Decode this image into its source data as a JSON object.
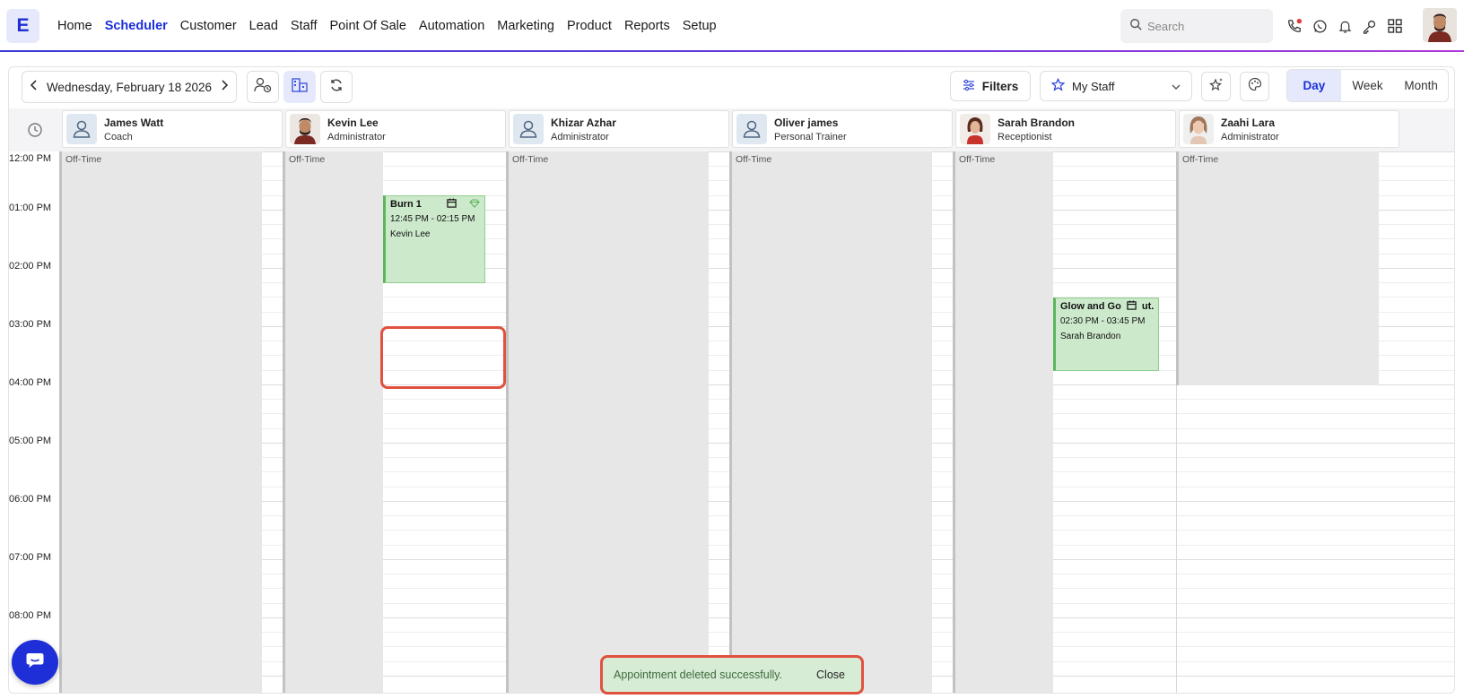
{
  "app": {
    "logo_letter": "E"
  },
  "nav": {
    "items": [
      {
        "label": "Home",
        "active": false
      },
      {
        "label": "Scheduler",
        "active": true
      },
      {
        "label": "Customer",
        "active": false
      },
      {
        "label": "Lead",
        "active": false
      },
      {
        "label": "Staff",
        "active": false
      },
      {
        "label": "Point Of Sale",
        "active": false
      },
      {
        "label": "Automation",
        "active": false
      },
      {
        "label": "Marketing",
        "active": false
      },
      {
        "label": "Product",
        "active": false
      },
      {
        "label": "Reports",
        "active": false
      },
      {
        "label": "Setup",
        "active": false
      }
    ],
    "search_placeholder": "Search",
    "icons": [
      "phone-icon",
      "whatsapp-icon",
      "bell-icon",
      "key-icon",
      "apps-grid-icon"
    ]
  },
  "toolbar": {
    "date": "Wednesday, February 18 2026",
    "filters_label": "Filters",
    "staff_select": "My Staff",
    "views": [
      {
        "label": "Day",
        "active": true
      },
      {
        "label": "Week",
        "active": false
      },
      {
        "label": "Month",
        "active": false
      }
    ]
  },
  "staff": [
    {
      "name": "James Watt",
      "role": "Coach",
      "photo": false
    },
    {
      "name": "Kevin Lee",
      "role": "Administrator",
      "photo": true
    },
    {
      "name": "Khizar Azhar",
      "role": "Administrator",
      "photo": false
    },
    {
      "name": "Oliver james",
      "role": "Personal Trainer",
      "photo": false
    },
    {
      "name": "Sarah Brandon",
      "role": "Receptionist",
      "photo": true
    },
    {
      "name": "Zaahi Lara",
      "role": "Administrator",
      "photo": true
    }
  ],
  "times": [
    "12:00 PM",
    "01:00 PM",
    "02:00 PM",
    "03:00 PM",
    "04:00 PM",
    "05:00 PM",
    "06:00 PM",
    "07:00 PM",
    "08:00 PM"
  ],
  "offtime_label": "Off-Time",
  "appointments": [
    {
      "title": "Burn 1",
      "time": "12:45 PM - 02:15 PM",
      "staff": "Kevin Lee"
    },
    {
      "title": "Glow and Go",
      "title_suffix": "ut..",
      "time": "02:30 PM - 03:45 PM",
      "staff": "Sarah Brandon"
    }
  ],
  "toast": {
    "message": "Appointment deleted successfully.",
    "close_label": "Close"
  },
  "colors": {
    "accent": "#1a2fd8",
    "appointment": "#cde9cc",
    "offtime": "#e7e7e7",
    "highlight": "#e0513f"
  }
}
